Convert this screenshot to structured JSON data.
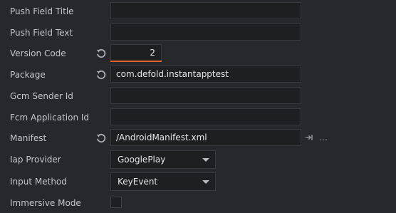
{
  "properties": {
    "push_field_title": {
      "label": "Push Field Title",
      "value": ""
    },
    "push_field_text": {
      "label": "Push Field Text",
      "value": ""
    },
    "version_code": {
      "label": "Version Code",
      "value": "2"
    },
    "package": {
      "label": "Package",
      "value": "com.defold.instantapptest"
    },
    "gcm_sender_id": {
      "label": "Gcm Sender Id",
      "value": ""
    },
    "fcm_application_id": {
      "label": "Fcm Application Id",
      "value": ""
    },
    "manifest": {
      "label": "Manifest",
      "value": "/AndroidManifest.xml",
      "more_label": "…"
    },
    "iap_provider": {
      "label": "Iap Provider",
      "value": "GooglePlay"
    },
    "input_method": {
      "label": "Input Method",
      "value": "KeyEvent"
    },
    "immersive_mode": {
      "label": "Immersive Mode",
      "checked": false
    }
  },
  "icons": {
    "reset": "reset-icon",
    "goto": "goto-file-icon",
    "dropdown": "chevron-down-icon"
  },
  "colors": {
    "background": "#26282b",
    "field": "#1d1f21",
    "accent": "#e0642b"
  }
}
